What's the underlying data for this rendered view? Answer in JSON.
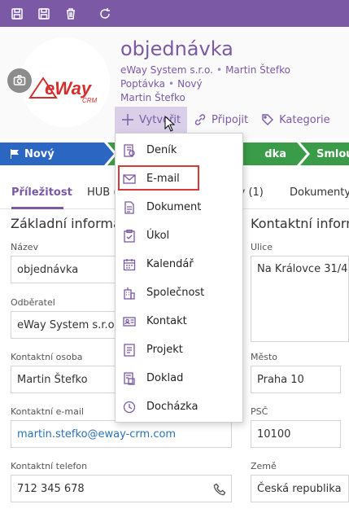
{
  "toolbar": {
    "icons": [
      "save-icon",
      "save-close-icon",
      "delete-icon",
      "refresh-icon"
    ]
  },
  "header": {
    "title": "objednávka",
    "company": "eWay System s.r.o.",
    "owner": "Martin Štefko",
    "type": "Poptávka",
    "state": "Nový",
    "supervisor": "Martin Štefko",
    "logo_text": "eWay",
    "logo_subtext": "CRM",
    "dot": "•"
  },
  "actions": {
    "create": "Vytvořit",
    "attach": "Připojit",
    "category": "Kategorie"
  },
  "pipeline": {
    "step1": "Nový",
    "step2": "dka",
    "step3": "Smlouv"
  },
  "tabs": {
    "t1": "Příležitost",
    "t2": "HUB (",
    "t3": "ly (1)",
    "t4": "Dokumenty"
  },
  "sections": {
    "left_title": "Základní informa",
    "right_title": "Kontaktní inform"
  },
  "fields": {
    "name_label": "Název",
    "name_value": "objednávka",
    "customer_label": "Odběratel",
    "customer_value": "eWay System s.r.o.",
    "contact_label": "Kontaktní osoba",
    "contact_value": "Martin Štefko",
    "email_label": "Kontaktní e-mail",
    "email_value": "martin.stefko@eway-crm.com",
    "phone_label": "Kontaktní telefon",
    "phone_value": "712 345 678",
    "street_label": "Ulice",
    "street_value": "Na Královce 31/4",
    "city_label": "Město",
    "city_value": "Praha 10",
    "zip_label": "PSČ",
    "zip_value": "10100",
    "country_label": "Země",
    "country_value": "Česká republika"
  },
  "menu": {
    "items": [
      "Deník",
      "E-mail",
      "Dokument",
      "Úkol",
      "Kalendář",
      "Společnost",
      "Kontakt",
      "Projekt",
      "Doklad",
      "Docházka"
    ],
    "highlighted": "E-mail"
  },
  "colors": {
    "accent": "#7b59a5",
    "pipeline_blue": "#2b66c2",
    "pipeline_green": "#3a9c48",
    "highlight_red": "#d43a3a",
    "link": "#2a72b8"
  }
}
